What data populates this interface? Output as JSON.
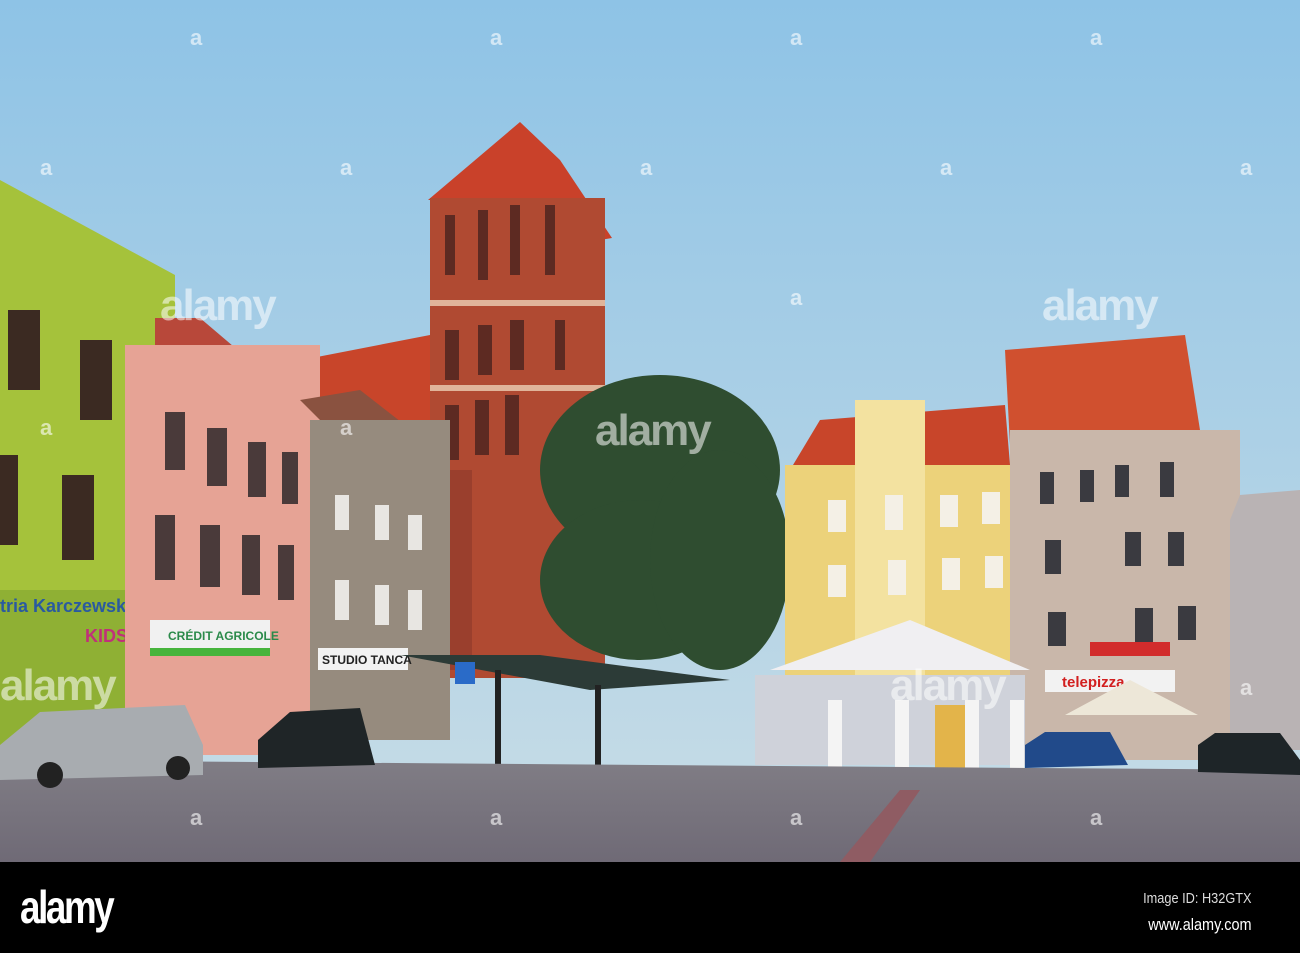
{
  "watermark": {
    "text": "alamy",
    "small": "a"
  },
  "signs": {
    "shop_left": "tria Karczewski",
    "shop_kids": "KIDS",
    "bank": "CRÉDIT AGRICOLE",
    "studio": "STUDIO TANCA",
    "pizza": "telepizza"
  },
  "footer": {
    "logo": "alamy",
    "image_id": "Image ID: H32GTX",
    "url": "www.alamy.com"
  }
}
